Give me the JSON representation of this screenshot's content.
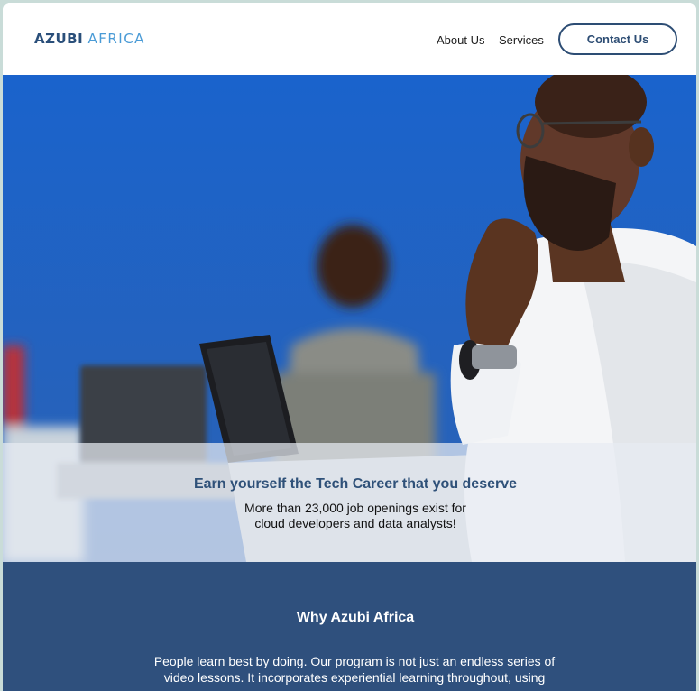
{
  "header": {
    "logo_part1": "AZUBI",
    "logo_part2": "AFRICA",
    "nav": {
      "about": "About Us",
      "services": "Services"
    },
    "contact_label": "Contact Us"
  },
  "hero": {
    "title": "Earn yourself the Tech Career that you deserve",
    "subtitle": "More than 23,000 job openings exist for cloud developers and data analysts!"
  },
  "why": {
    "title": "Why Azubi Africa",
    "body": "People learn best by doing. Our program is not just an endless series of video lessons. It incorporates experiential learning throughout, using"
  },
  "colors": {
    "brand_dark": "#2d4d74",
    "brand_light": "#4a9bd6",
    "section_bg": "#2f507d",
    "hero_blue": "#1b66cf"
  }
}
